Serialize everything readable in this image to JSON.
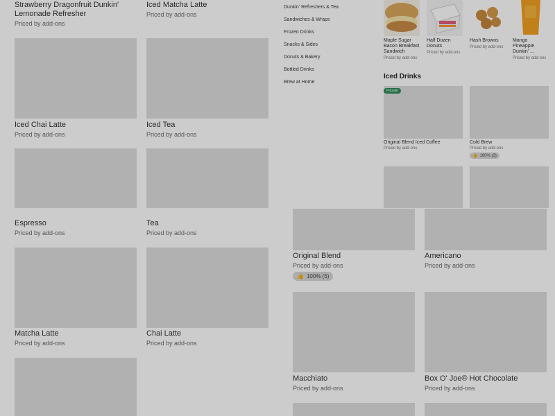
{
  "left_top": {
    "items": [
      {
        "name": "Strawberry Dragonfruit Dunkin' Lemonade Refresher",
        "price": "Priced by add-ons"
      },
      {
        "name": "Iced Matcha Latte",
        "price": "Priced by add-ons"
      },
      {
        "name": "Iced Chai Latte",
        "price": "Priced by add-ons"
      },
      {
        "name": "Iced Tea",
        "price": "Priced by add-ons"
      }
    ]
  },
  "right_top": {
    "nav": [
      "Dunkin' Refreshers & Tea",
      "Sandwiches & Wraps",
      "Frozen Drinks",
      "Snacks & Sides",
      "Donuts & Bakery",
      "Bottled Drinks",
      "Brew at Home"
    ],
    "featured": [
      {
        "name": "Maple Sugar Bacon Breakfast Sandwich",
        "price": "Priced by add-ons",
        "icon": "sandwich-image"
      },
      {
        "name": "Half Dozen Donuts",
        "price": "Priced by add-ons",
        "icon": "donut-box-image"
      },
      {
        "name": "Hash Browns",
        "price": "Priced by add-ons",
        "icon": "hash-browns-image"
      },
      {
        "name": "Mango Pineapple Dunkin' ...",
        "price": "Priced by add-ons",
        "icon": "drink-cup-image"
      }
    ],
    "iced_section_title": "Iced Drinks",
    "popular_badge": "Popular",
    "iced_items": [
      {
        "name": "Original Blend Iced Coffee",
        "price": "Priced by add-ons"
      },
      {
        "name": "Cold Brew",
        "price": "Priced by add-ons",
        "rating": "100% (3)"
      }
    ]
  },
  "left_bottom": {
    "items": [
      {
        "name": "Espresso",
        "price": "Priced by add-ons"
      },
      {
        "name": "Tea",
        "price": "Priced by add-ons"
      },
      {
        "name": "Matcha Latte",
        "price": "Priced by add-ons"
      },
      {
        "name": "Chai Latte",
        "price": "Priced by add-ons"
      }
    ]
  },
  "right_bottom": {
    "items": [
      {
        "name": "Original Blend",
        "price": "Priced by add-ons",
        "rating": "100% (5)"
      },
      {
        "name": "Americano",
        "price": "Priced by add-ons"
      },
      {
        "name": "Macchiato",
        "price": "Priced by add-ons"
      },
      {
        "name": "Box O' Joe® Hot Chocolate",
        "price": "Priced by add-ons"
      }
    ]
  },
  "colors": {
    "placeholder": "#dedede",
    "overlay": "rgba(0,0,0,0.2)",
    "badge_green": "#2e8b57",
    "drink_orange": "#f2a020"
  }
}
